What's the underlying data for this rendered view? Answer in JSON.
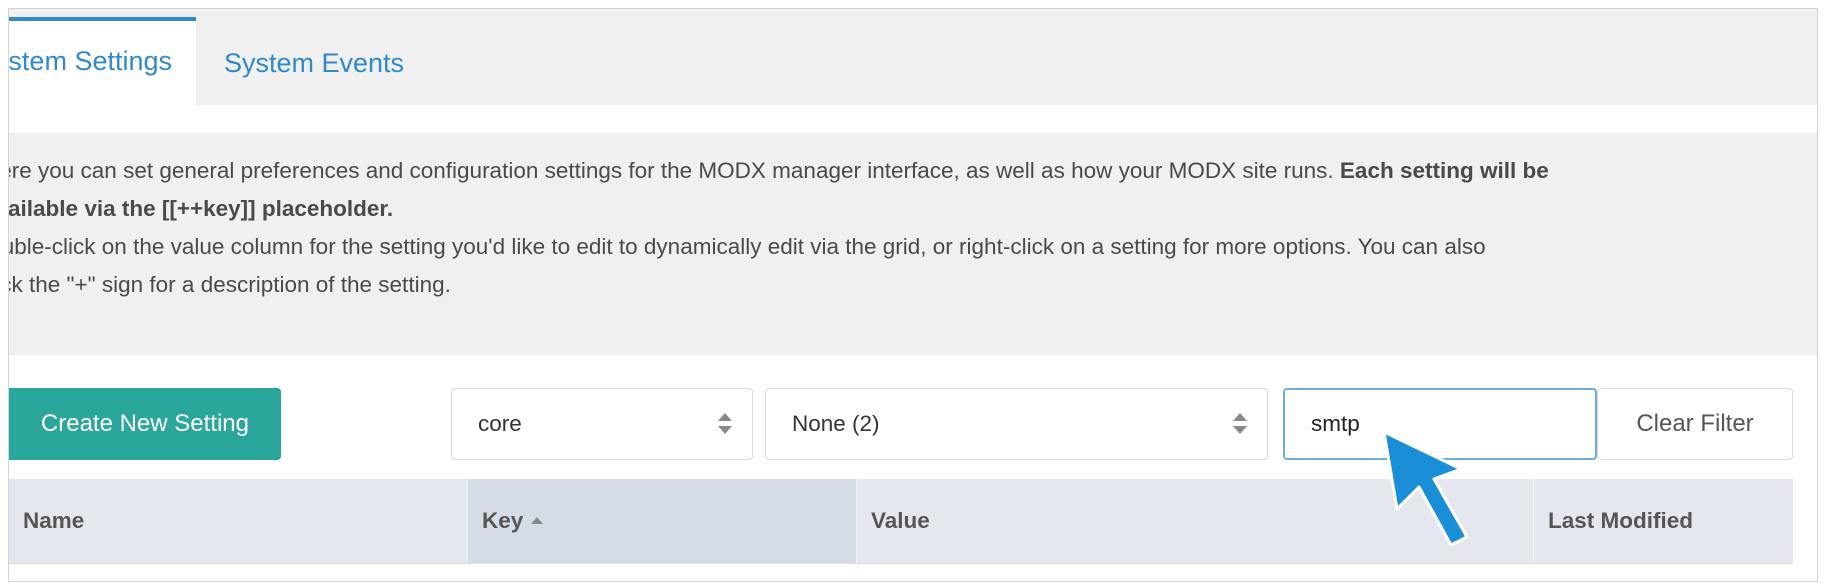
{
  "tabs": [
    {
      "label": "System Settings",
      "active": true
    },
    {
      "label": "System Events",
      "active": false
    }
  ],
  "info": {
    "line1_text": "Here you can set general preferences and configuration settings for the MODX manager interface, as well as how your MODX site runs. ",
    "line1_bold": "Each setting will be",
    "line2_bold": "available via the [[++key]] placeholder.",
    "line3": "Double-click on the value column for the setting you'd like to edit to dynamically edit via the grid, or right-click on a setting for more options. You can also",
    "line4": "click the \"+\" sign for a description of the setting."
  },
  "toolbar": {
    "create_label": "Create New Setting",
    "namespace_value": "core",
    "area_value": "None (2)",
    "filter_value": "smtp",
    "clear_label": "Clear Filter"
  },
  "grid": {
    "columns": [
      "Name",
      "Key",
      "Value",
      "Last Modified"
    ],
    "sorted_column": "Key"
  },
  "colors": {
    "accent_blue": "#2f89cc",
    "button_teal": "#2aa79a",
    "header_bg": "#e4e8ee",
    "cursor_blue": "#1a8fd8"
  }
}
